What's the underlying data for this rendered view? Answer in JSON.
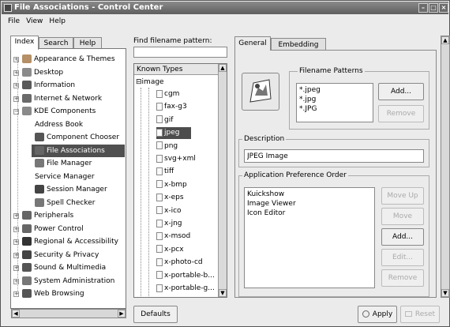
{
  "window": {
    "title": "File Associations - Control Center"
  },
  "menu": [
    "File",
    "View",
    "Help"
  ],
  "left_tabs": [
    "Index",
    "Search",
    "Help"
  ],
  "tree": [
    {
      "label": "Appearance & Themes",
      "icon_color": "#b58f66"
    },
    {
      "label": "Desktop",
      "icon_color": "#8b8b8b"
    },
    {
      "label": "Information",
      "icon_color": "#5a5a5a"
    },
    {
      "label": "Internet & Network",
      "icon_color": "#6a6a6a"
    },
    {
      "label": "KDE Components",
      "icon_color": "#8a8a8a"
    },
    {
      "label": "Address Book",
      "icon_color": ""
    },
    {
      "label": "Component Chooser",
      "icon_color": "#555"
    },
    {
      "label": "File Associations",
      "icon_color": "#666",
      "selected": true
    },
    {
      "label": "File Manager",
      "icon_color": "#777"
    },
    {
      "label": "Service Manager",
      "icon_color": ""
    },
    {
      "label": "Session Manager",
      "icon_color": "#444"
    },
    {
      "label": "Spell Checker",
      "icon_color": "#777"
    },
    {
      "label": "Peripherals",
      "icon_color": "#666"
    },
    {
      "label": "Power Control",
      "icon_color": "#666"
    },
    {
      "label": "Regional & Accessibility",
      "icon_color": "#333"
    },
    {
      "label": "Security & Privacy",
      "icon_color": "#444"
    },
    {
      "label": "Sound & Multimedia",
      "icon_color": "#555"
    },
    {
      "label": "System Administration",
      "icon_color": "#777"
    },
    {
      "label": "Web Browsing",
      "icon_color": "#555"
    }
  ],
  "find": {
    "label": "Find filename pattern:",
    "value": ""
  },
  "types": {
    "header": "Known Types",
    "group": "image",
    "items": [
      "cgm",
      "fax-g3",
      "gif",
      "jpeg",
      "png",
      "svg+xml",
      "tiff",
      "x-bmp",
      "x-eps",
      "x-ico",
      "x-jng",
      "x-msod",
      "x-pcx",
      "x-photo-cd",
      "x-portable-b...",
      "x-portable-g..."
    ],
    "selected": "jpeg"
  },
  "right_tabs": [
    "General",
    "Embedding"
  ],
  "patterns": {
    "title": "Filename Patterns",
    "items": [
      "*.jpeg",
      "*.jpg",
      "*.JPG"
    ],
    "add": "Add...",
    "remove": "Remove"
  },
  "description": {
    "title": "Description",
    "value": "JPEG Image"
  },
  "app_order": {
    "title": "Application Preference Order",
    "items": [
      "Kuickshow",
      "Image Viewer",
      "Icon Editor"
    ],
    "buttons": [
      "Move Up",
      "Move Down",
      "Add...",
      "Edit...",
      "Remove"
    ]
  },
  "bottom": {
    "defaults": "Defaults",
    "apply": "Apply",
    "reset": "Reset"
  },
  "colors": {
    "title_bar": "#6e6e6e",
    "selection": "#4d4d4d",
    "window_bg": "#ebebeb"
  }
}
